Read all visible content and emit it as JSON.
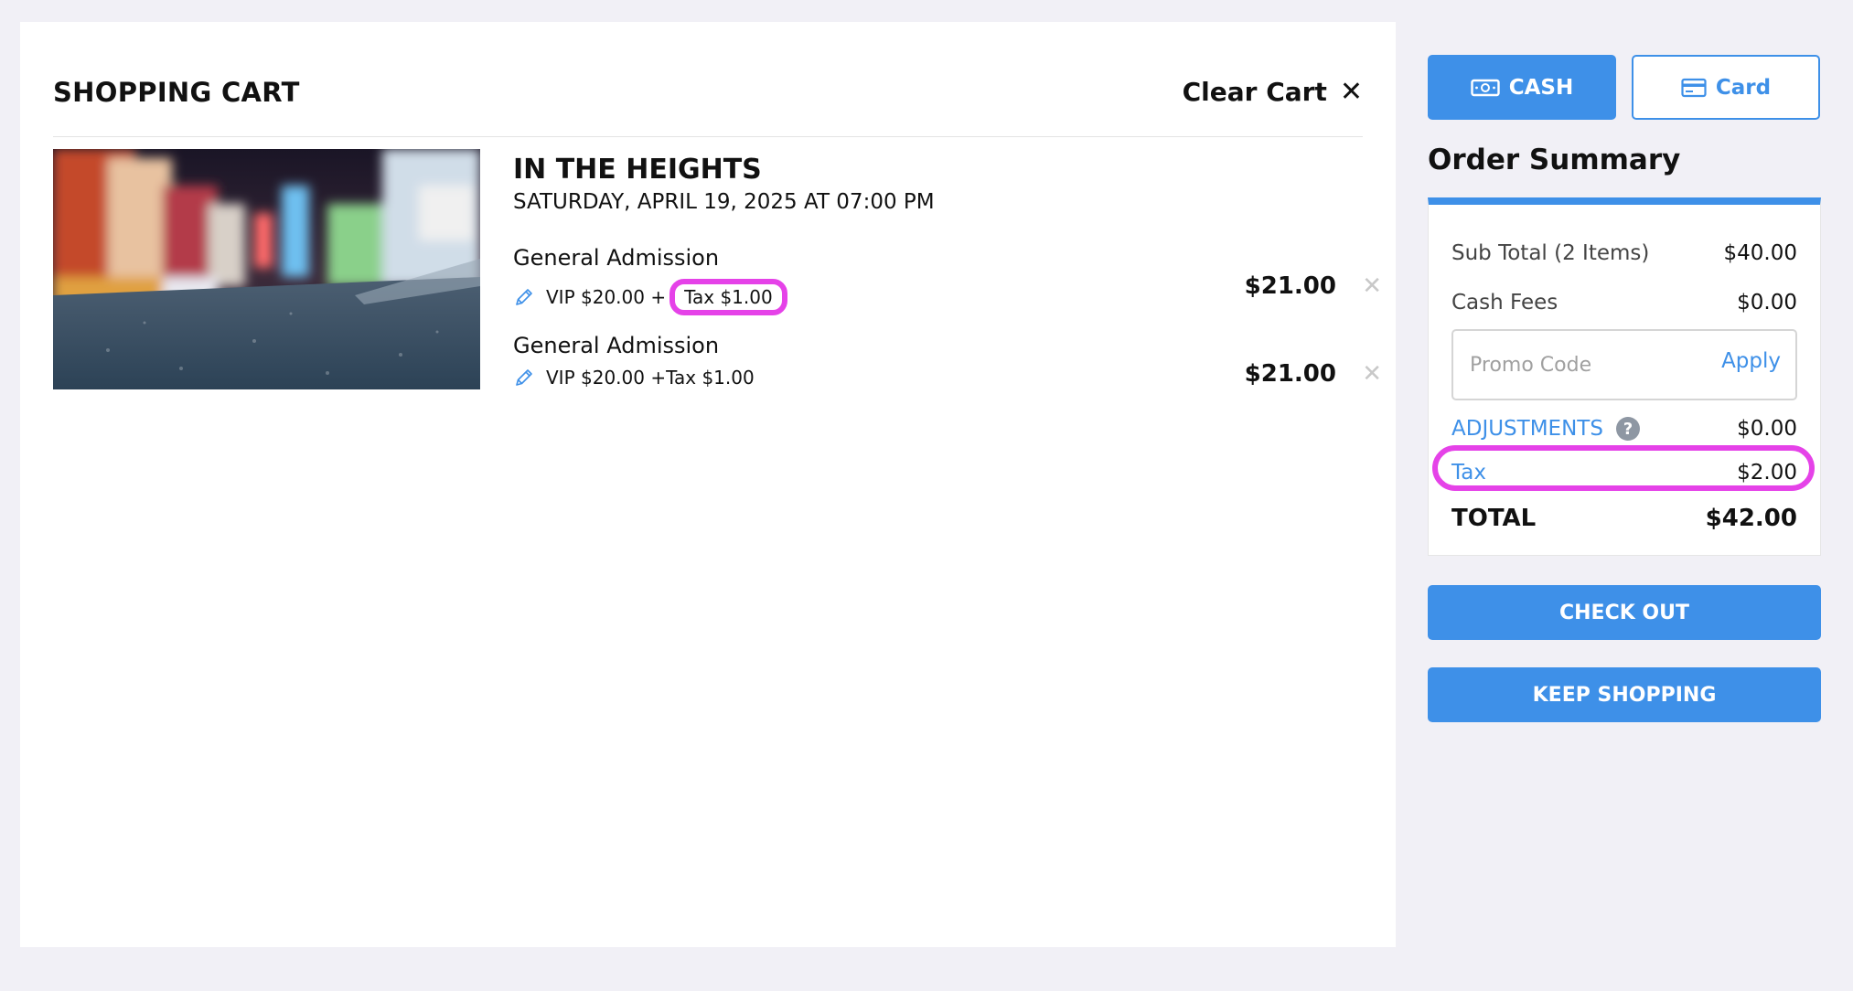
{
  "cart": {
    "title": "SHOPPING CART",
    "clear_label": "Clear Cart",
    "clear_icon": "✕"
  },
  "event": {
    "title": "IN THE HEIGHTS",
    "date": "SATURDAY, APRIL 19, 2025 AT 07:00 PM",
    "image_icon": "event-photo",
    "tickets": [
      {
        "name": "General Admission",
        "price_base": "VIP $20.00 + ",
        "tax": "Tax $1.00",
        "total": "$21.00",
        "remove": "✕",
        "tax_highlighted": true
      },
      {
        "name": "General Admission",
        "price_base": "VIP $20.00 + ",
        "tax": "Tax $1.00",
        "total": "$21.00",
        "remove": "✕",
        "tax_highlighted": false
      }
    ]
  },
  "payment": {
    "cash_label": "CASH",
    "card_label": "Card",
    "cash_icon": "cash-icon",
    "card_icon": "card-icon",
    "selected": "CASH"
  },
  "summary": {
    "heading": "Order Summary",
    "subtotal_label": "Sub Total (2 Items)",
    "subtotal_value": "$40.00",
    "cash_fees_label": "Cash Fees",
    "cash_fees_value": "$0.00",
    "promo_placeholder": "Promo Code",
    "promo_apply": "Apply",
    "adjustments_label": "ADJUSTMENTS",
    "adjustments_help": "?",
    "adjustments_value": "$0.00",
    "tax_label": "Tax",
    "tax_value": "$2.00",
    "total_label": "TOTAL",
    "total_value": "$42.00"
  },
  "actions": {
    "checkout": "CHECK OUT",
    "keep_shopping": "KEEP SHOPPING"
  },
  "colors": {
    "accent": "#3e90e8",
    "highlight": "#e542e8",
    "background": "#f1f0f6"
  }
}
